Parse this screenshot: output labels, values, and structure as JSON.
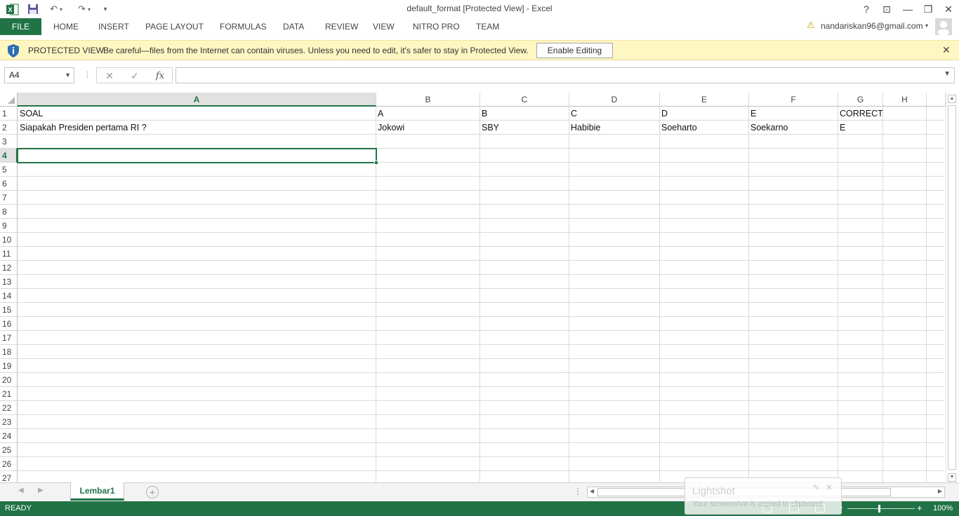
{
  "window": {
    "title": "default_format  [Protected View] - Excel",
    "help": "?",
    "minimize": "—",
    "restore": "❐",
    "close": "✕",
    "ribbon_display": "⊡"
  },
  "quick_access": {
    "excel_logo": "X",
    "save_icon": "save-icon",
    "undo": "↶",
    "redo": "↷",
    "customize": "▾"
  },
  "ribbon": {
    "file": "FILE",
    "tabs": [
      "HOME",
      "INSERT",
      "PAGE LAYOUT",
      "FORMULAS",
      "DATA",
      "REVIEW",
      "VIEW",
      "NITRO PRO",
      "TEAM"
    ],
    "account": "nandariskan96@gmail.com",
    "warning": "⚠"
  },
  "protected_view": {
    "title": "PROTECTED VIEW",
    "message": "Be careful—files from the Internet can contain viruses. Unless you need to edit, it's safer to stay in Protected View.",
    "button": "Enable Editing",
    "close": "✕"
  },
  "formula_bar": {
    "name_box": "A4",
    "cancel": "✕",
    "enter": "✓",
    "fx": "fx",
    "value": ""
  },
  "sheet": {
    "columns": [
      "A",
      "B",
      "C",
      "D",
      "E",
      "F",
      "G",
      "H"
    ],
    "selected_column": "A",
    "rows": [
      "1",
      "2",
      "3",
      "4",
      "5",
      "6",
      "7",
      "8",
      "9",
      "10",
      "11",
      "12",
      "13",
      "14",
      "15",
      "16",
      "17",
      "18",
      "19",
      "20",
      "21",
      "22",
      "23",
      "24",
      "25",
      "26",
      "27"
    ],
    "selected_row": "4",
    "cells": {
      "row1": [
        "SOAL",
        "A",
        "B",
        "C",
        "D",
        "E",
        "CORRECT"
      ],
      "row2": [
        "Siapakah Presiden pertama RI ?",
        "Jokowi",
        "SBY",
        "Habibie",
        "Soeharto",
        "Soekarno",
        "E"
      ]
    }
  },
  "sheet_tabs": {
    "active": "Lembar1",
    "add": "+",
    "prev": "◀",
    "next": "▶"
  },
  "status": {
    "ready": "READY",
    "zoom": "100%",
    "zoom_minus": "−",
    "zoom_plus": "+"
  },
  "toast": {
    "title": "Lightshot",
    "message": "Your screenshot is copied to clipboard"
  },
  "colors": {
    "accent": "#217346",
    "protected_bar": "#fff7c2",
    "shield": "#2e6fb5"
  }
}
